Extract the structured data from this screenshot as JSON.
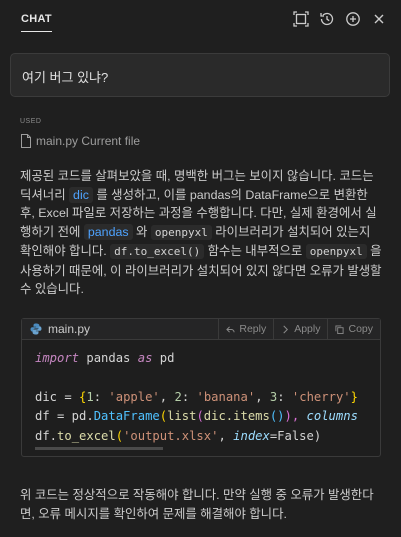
{
  "header": {
    "title": "CHAT",
    "icons": [
      "expand-icon",
      "history-icon",
      "new-chat-icon",
      "close-icon"
    ]
  },
  "question": {
    "text": "여기 버그 있냐?"
  },
  "used": {
    "label": "USED",
    "file": "main.py",
    "suffix": " Current file"
  },
  "answer": {
    "p1_a": "제공된 코드를 살펴보았을 때, 명백한 버그는 보이지 않습니다. 코드는 딕셔너리 ",
    "p1_dic": "dic",
    "p1_b": " 를 생성하고, 이를 pandas의 DataFrame으로 변환한 후, Excel 파일로 저장하는 과정을 수행합니다. 다만, 실제 환경에서 실행하기 전에 ",
    "p1_pandas": "pandas",
    "p1_c": " 와 ",
    "p1_openpyxl": "openpyxl",
    "p1_d": " 라이브러리가 설치되어 있는지 확인해야 합니다. ",
    "p1_toexcel": "df.to_excel()",
    "p1_e": " 함수는 내부적으로 ",
    "p1_openpyxl2": "openpyxl",
    "p1_f": " 을 사용하기 때문에, 이 라이브러리가 설치되어 있지 않다면 오류가 발생할 수 있습니다.",
    "p2": "위 코드는 정상적으로 작동해야 합니다. 만약 실행 중 오류가 발생한다면, 오류 메시지를 확인하여 문제를 해결해야 합니다."
  },
  "codeblock": {
    "filename": "main.py",
    "reply": "Reply",
    "apply": "Apply",
    "copy": "Copy",
    "code": {
      "l1_import": "import",
      "l1_mod": " pandas ",
      "l1_as": "as",
      "l1_alias": " pd",
      "l3_a": "dic = ",
      "l3_ob": "{",
      "l3_1": "1",
      "l3_s1": "'apple'",
      "l3_2": "2",
      "l3_s2": "'banana'",
      "l3_3": "3",
      "l3_s3": "'cherry'",
      "l3_cb": "}",
      "l4_a": "df = pd.",
      "l4_df": "DataFrame",
      "l4_p1": "(",
      "l4_list": "list",
      "l4_p2": "(",
      "l4_items": "dic.items",
      "l4_p3": "()",
      "l4_p4": "), ",
      "l4_col": "columns",
      "l5_a": "df.",
      "l5_fn": "to_excel",
      "l5_p1": "(",
      "l5_s": "'output.xlsx'",
      "l5_b": ", ",
      "l5_idx": "index",
      "l5_c": "=False)"
    }
  },
  "colors": {
    "accent": "#4ea3ff",
    "background": "#1f1f1f"
  }
}
